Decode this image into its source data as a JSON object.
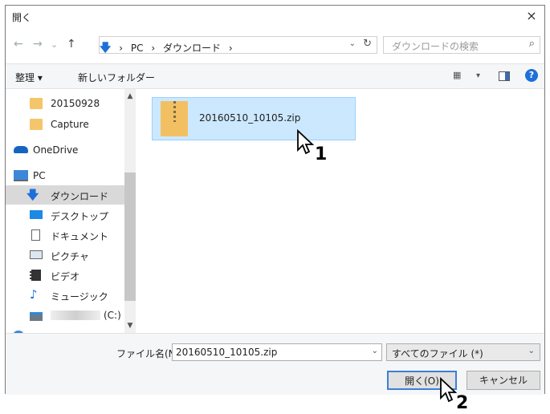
{
  "window": {
    "title": "開く",
    "close_glyph": "×"
  },
  "nav_buttons": {
    "back": "←",
    "forward": "→",
    "recent": "⌄",
    "up": "↑"
  },
  "address": {
    "crumbs": [
      "PC",
      "ダウンロード"
    ],
    "separator": "›",
    "dropdown_glyph": "⌄",
    "refresh_glyph": "↻"
  },
  "search": {
    "placeholder": "ダウンロードの検索",
    "icon_glyph": "⌕"
  },
  "toolbar": {
    "organize": "整理 ▾",
    "new_folder": "新しいフォルダー",
    "view_dd": "▾",
    "help": "?"
  },
  "sidebar": {
    "items": [
      {
        "label": "20150928"
      },
      {
        "label": "Capture"
      },
      {
        "label": "OneDrive"
      },
      {
        "label": "PC"
      },
      {
        "label": "ダウンロード"
      },
      {
        "label": "デスクトップ"
      },
      {
        "label": "ドキュメント"
      },
      {
        "label": "ピクチャ"
      },
      {
        "label": "ビデオ"
      },
      {
        "label": "ミュージック"
      },
      {
        "label": "(C:)"
      }
    ]
  },
  "files": [
    {
      "name": "20160510_10105.zip"
    }
  ],
  "bottom": {
    "filename_label": "ファイル名(N):",
    "filename_value": "20160510_10105.zip",
    "filetype_value": "すべてのファイル (*)",
    "open_label": "開く(O)",
    "cancel_label": "キャンセル"
  },
  "callouts": {
    "first": "1",
    "second": "2"
  },
  "colors": {
    "selection": "#cce8ff",
    "folder": "#f5c56b",
    "accent": "#3c7fd9"
  }
}
